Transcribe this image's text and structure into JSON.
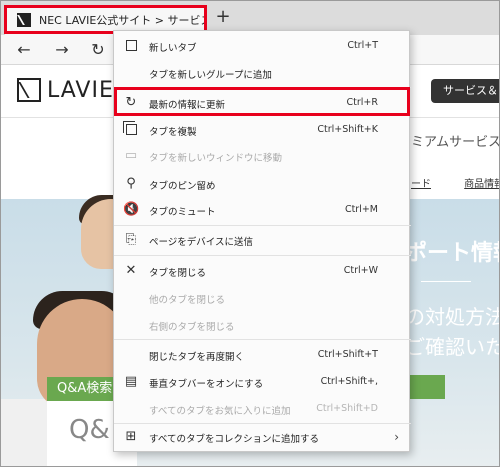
{
  "browser": {
    "tab_title": "NEC LAVIE公式サイト > サービス＆",
    "new_tab_symbol": "+",
    "nav": {
      "back": "←",
      "forward": "→",
      "reload": "↻"
    }
  },
  "page": {
    "logo_text": "LAVIE",
    "support_button": "サービス＆",
    "premium_text": "ミアムサービス",
    "links": [
      "ード",
      "商品情報"
    ],
    "hero_title": "ポート情報",
    "hero_sub1": "の対処方法",
    "hero_sub2": "ご確認いた",
    "qa_tag": "Q&A検索",
    "qa_big": "Q&"
  },
  "menu": {
    "items": [
      {
        "label": "新しいタブ",
        "shortcut": "Ctrl+T",
        "icon": "new-tab-icon",
        "enabled": true
      },
      {
        "label": "タブを新しいグループに追加",
        "shortcut": "",
        "icon": "",
        "enabled": true
      },
      {
        "label": "最新の情報に更新",
        "shortcut": "Ctrl+R",
        "icon": "refresh-icon",
        "enabled": true
      },
      {
        "label": "タブを複製",
        "shortcut": "Ctrl+Shift+K",
        "icon": "duplicate-icon",
        "enabled": true
      },
      {
        "label": "タブを新しいウィンドウに移動",
        "shortcut": "",
        "icon": "window-icon",
        "enabled": false
      },
      {
        "label": "タブのピン留め",
        "shortcut": "",
        "icon": "pin-icon",
        "enabled": true
      },
      {
        "label": "タブのミュート",
        "shortcut": "Ctrl+M",
        "icon": "mute-icon",
        "enabled": true
      },
      {
        "label": "ページをデバイスに送信",
        "shortcut": "",
        "icon": "send-device-icon",
        "enabled": true
      },
      {
        "label": "タブを閉じる",
        "shortcut": "Ctrl+W",
        "icon": "close-icon",
        "enabled": true
      },
      {
        "label": "他のタブを閉じる",
        "shortcut": "",
        "icon": "",
        "enabled": false
      },
      {
        "label": "右側のタブを閉じる",
        "shortcut": "",
        "icon": "",
        "enabled": false
      },
      {
        "label": "閉じたタブを再度開く",
        "shortcut": "Ctrl+Shift+T",
        "icon": "",
        "enabled": true
      },
      {
        "label": "垂直タブバーをオンにする",
        "shortcut": "Ctrl+Shift+,",
        "icon": "vertical-tabs-icon",
        "enabled": true
      },
      {
        "label": "すべてのタブをお気に入りに追加",
        "shortcut": "Ctrl+Shift+D",
        "icon": "",
        "enabled": false
      },
      {
        "label": "すべてのタブをコレクションに追加する",
        "shortcut": "",
        "icon": "collections-icon",
        "enabled": true,
        "submenu_arrow": "›"
      }
    ]
  },
  "colors": {
    "highlight": "#e8001c",
    "menu_bg": "#fbfbfb",
    "hero_accent": "#6aa84f"
  }
}
